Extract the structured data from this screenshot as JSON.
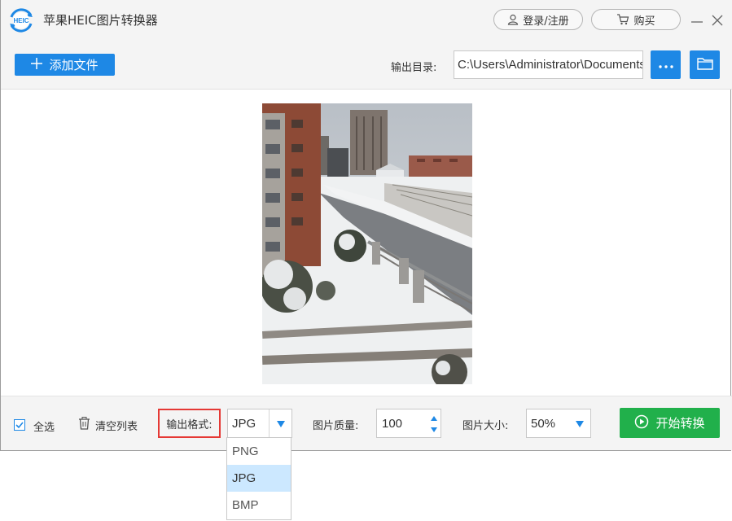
{
  "app": {
    "title": "苹果HEIC图片转换器",
    "logo_text": "HEIC"
  },
  "header": {
    "login_label": "登录/注册",
    "buy_label": "购买"
  },
  "toolbar": {
    "add_file_label": "添加文件",
    "output_dir_label": "输出目录:",
    "output_dir_value": "C:\\Users\\Administrator\\Documents"
  },
  "bottom": {
    "select_all_label": "全选",
    "clear_list_label": "清空列表",
    "format_label": "输出格式:",
    "format_value": "JPG",
    "quality_label": "图片质量:",
    "quality_value": "100",
    "size_label": "图片大小:",
    "size_value": "50%",
    "start_label": "开始转换"
  },
  "format_dropdown": {
    "options": [
      "PNG",
      "JPG",
      "BMP"
    ],
    "selected": "JPG"
  },
  "colors": {
    "accent_blue": "#1e88e5",
    "start_green": "#21b04b",
    "highlight_red": "#e53935",
    "selected_option": "#cce8ff"
  }
}
